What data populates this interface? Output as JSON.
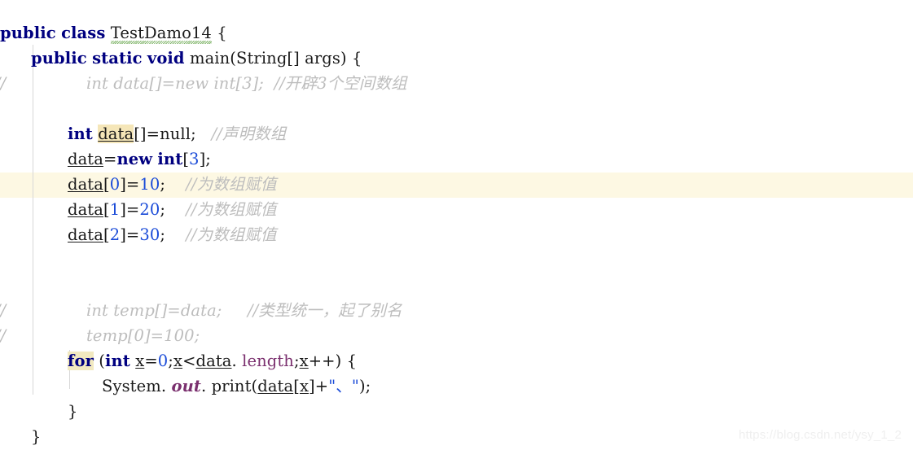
{
  "editor": {
    "language": "java",
    "current_line_number": 7,
    "colors": {
      "background": "#ffffff",
      "keyword": "#000080",
      "number": "#1a4bd8",
      "string": "#1a4bd8",
      "comment": "#bdbdbd",
      "field": "#7a2f6e",
      "occurrence_highlight": "#f5e6b8",
      "current_line_highlight": "#fdf8e3",
      "indent_guide": "#d7d7d7",
      "spellcheck_squiggle": "#6aa84f"
    }
  },
  "gutter": {
    "comment_marker": "//"
  },
  "code": {
    "lines": [
      {
        "id": "line-1",
        "tokens": [
          {
            "t": "public",
            "k": "kw"
          },
          {
            "t": " ",
            "k": "plain"
          },
          {
            "t": "class",
            "k": "kw"
          },
          {
            "t": " ",
            "k": "plain"
          },
          {
            "t": "TestDamo14",
            "k": "squiggle"
          },
          {
            "t": " {",
            "k": "brace"
          }
        ]
      },
      {
        "id": "line-2",
        "tokens": [
          {
            "t": "public",
            "k": "kw"
          },
          {
            "t": " ",
            "k": "plain"
          },
          {
            "t": "static",
            "k": "kw"
          },
          {
            "t": " ",
            "k": "plain"
          },
          {
            "t": "void",
            "k": "kw"
          },
          {
            "t": " ",
            "k": "plain"
          },
          {
            "t": "main",
            "k": "plain"
          },
          {
            "t": "(",
            "k": "brace"
          },
          {
            "t": "String",
            "k": "plain"
          },
          {
            "t": "[] ",
            "k": "brace"
          },
          {
            "t": "args",
            "k": "plain"
          },
          {
            "t": ") {",
            "k": "brace"
          }
        ]
      },
      {
        "id": "line-3",
        "gutter": "//",
        "tokens": [
          {
            "t": "int data[]=new int[3];  //开辟3个空间数组",
            "k": "cmt"
          }
        ]
      },
      {
        "id": "line-4",
        "tokens": []
      },
      {
        "id": "line-5",
        "tokens": [
          {
            "t": "int",
            "k": "kw"
          },
          {
            "t": " ",
            "k": "plain"
          },
          {
            "t": "data",
            "k": "occ"
          },
          {
            "t": "[]=",
            "k": "brace"
          },
          {
            "t": "null",
            "k": "plain"
          },
          {
            "t": ";",
            "k": "brace"
          },
          {
            "t": "   ",
            "k": "plain"
          },
          {
            "t": "//声明数组",
            "k": "cmt"
          }
        ]
      },
      {
        "id": "line-6",
        "tokens": [
          {
            "t": "data",
            "k": "var"
          },
          {
            "t": "=",
            "k": "brace"
          },
          {
            "t": "new",
            "k": "kw"
          },
          {
            "t": " ",
            "k": "plain"
          },
          {
            "t": "int",
            "k": "kw"
          },
          {
            "t": "[",
            "k": "brace"
          },
          {
            "t": "3",
            "k": "num"
          },
          {
            "t": "];",
            "k": "brace"
          }
        ]
      },
      {
        "id": "line-7",
        "current": true,
        "tokens": [
          {
            "t": "data",
            "k": "var"
          },
          {
            "t": "[",
            "k": "brace"
          },
          {
            "t": "0",
            "k": "num"
          },
          {
            "t": "]=",
            "k": "brace"
          },
          {
            "t": "10",
            "k": "num"
          },
          {
            "t": ";",
            "k": "brace"
          },
          {
            "t": "    ",
            "k": "plain"
          },
          {
            "t": "//为数组赋值",
            "k": "cmt"
          }
        ]
      },
      {
        "id": "line-8",
        "tokens": [
          {
            "t": "data",
            "k": "var"
          },
          {
            "t": "[",
            "k": "brace"
          },
          {
            "t": "1",
            "k": "num"
          },
          {
            "t": "]=",
            "k": "brace"
          },
          {
            "t": "20",
            "k": "num"
          },
          {
            "t": ";",
            "k": "brace"
          },
          {
            "t": "    ",
            "k": "plain"
          },
          {
            "t": "//为数组赋值",
            "k": "cmt"
          }
        ]
      },
      {
        "id": "line-9",
        "tokens": [
          {
            "t": "data",
            "k": "var"
          },
          {
            "t": "[",
            "k": "brace"
          },
          {
            "t": "2",
            "k": "num"
          },
          {
            "t": "]=",
            "k": "brace"
          },
          {
            "t": "30",
            "k": "num"
          },
          {
            "t": ";",
            "k": "brace"
          },
          {
            "t": "    ",
            "k": "plain"
          },
          {
            "t": "//为数组赋值",
            "k": "cmt"
          }
        ]
      },
      {
        "id": "line-10",
        "tokens": []
      },
      {
        "id": "line-11",
        "tokens": []
      },
      {
        "id": "line-12",
        "gutter": "//",
        "tokens": [
          {
            "t": "int temp[]=data;     //类型统一，起了别名",
            "k": "cmt"
          }
        ]
      },
      {
        "id": "line-13",
        "gutter": "//",
        "tokens": [
          {
            "t": "temp[0]=100;",
            "k": "cmt"
          }
        ]
      },
      {
        "id": "line-14",
        "tokens": [
          {
            "t": "for",
            "k": "kw-occ"
          },
          {
            "t": " (",
            "k": "brace"
          },
          {
            "t": "int",
            "k": "kw"
          },
          {
            "t": " ",
            "k": "plain"
          },
          {
            "t": "x",
            "k": "var"
          },
          {
            "t": "=",
            "k": "brace"
          },
          {
            "t": "0",
            "k": "num"
          },
          {
            "t": ";",
            "k": "brace"
          },
          {
            "t": "x",
            "k": "var"
          },
          {
            "t": "<",
            "k": "brace"
          },
          {
            "t": "data",
            "k": "var"
          },
          {
            "t": ".",
            "k": "brace"
          },
          {
            "t": " ",
            "k": "plain"
          },
          {
            "t": "length",
            "k": "field"
          },
          {
            "t": ";",
            "k": "brace"
          },
          {
            "t": "x",
            "k": "var"
          },
          {
            "t": "++) {",
            "k": "brace"
          }
        ]
      },
      {
        "id": "line-15",
        "tokens": [
          {
            "t": "System",
            "k": "plain"
          },
          {
            "t": ". ",
            "k": "brace"
          },
          {
            "t": "out",
            "k": "static-f"
          },
          {
            "t": ". ",
            "k": "brace"
          },
          {
            "t": "print",
            "k": "plain"
          },
          {
            "t": "(",
            "k": "brace"
          },
          {
            "t": "data",
            "k": "var"
          },
          {
            "t": "[",
            "k": "brace"
          },
          {
            "t": "x",
            "k": "var"
          },
          {
            "t": "]+",
            "k": "brace"
          },
          {
            "t": "\"、\"",
            "k": "str"
          },
          {
            "t": ");",
            "k": "brace"
          }
        ]
      },
      {
        "id": "line-16",
        "tokens": [
          {
            "t": "}",
            "k": "brace"
          }
        ]
      },
      {
        "id": "line-17",
        "tokens": [
          {
            "t": "}",
            "k": "brace"
          }
        ]
      }
    ]
  },
  "watermark": {
    "text": "https://blog.csdn.net/ysy_1_2"
  }
}
